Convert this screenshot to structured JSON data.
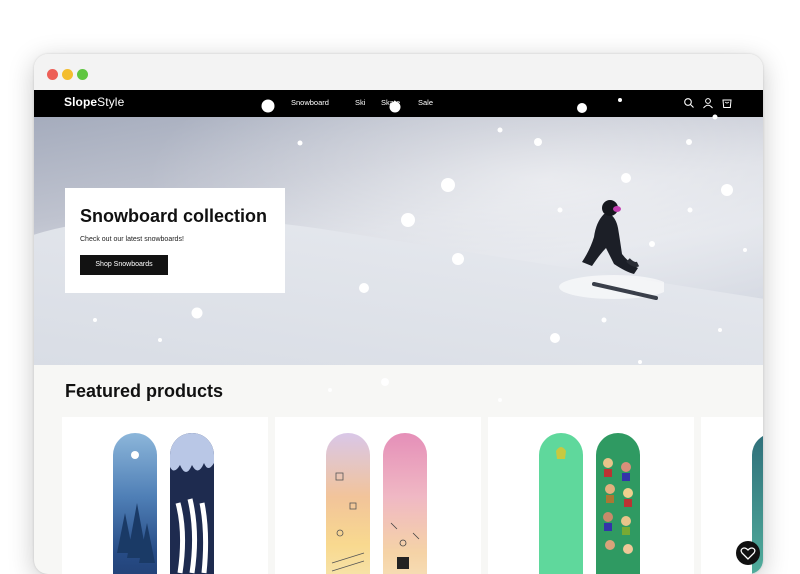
{
  "brand": {
    "name_bold": "Slope",
    "name_rest": "Style"
  },
  "nav": {
    "links": [
      "Snowboard",
      "Ski",
      "Skate",
      "Sale"
    ],
    "icons": [
      "search-icon",
      "account-icon",
      "cart-icon"
    ]
  },
  "hero": {
    "title": "Snowboard collection",
    "subtitle": "Check out our latest snowboards!",
    "button_label": "Shop Snowboards"
  },
  "featured": {
    "title": "Featured products"
  },
  "colors": {
    "nav_bg": "#000000",
    "button_bg": "#121212",
    "page_bg": "#f7f7f5",
    "traffic_red": "#ed5f57",
    "traffic_yellow": "#f3bd2e",
    "traffic_green": "#5fc640"
  }
}
